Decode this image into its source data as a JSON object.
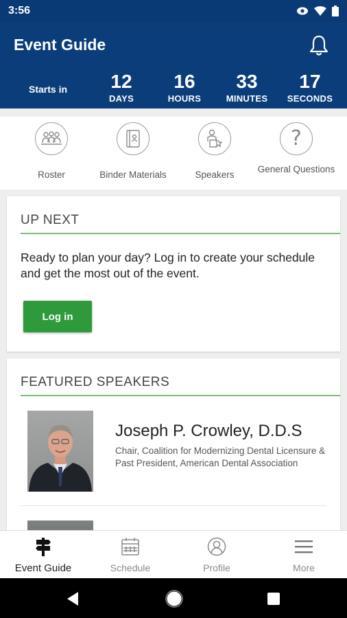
{
  "status_bar": {
    "time": "3:56",
    "icons": [
      "eye-icon",
      "wifi-icon",
      "battery-icon"
    ]
  },
  "header": {
    "title": "Event Guide",
    "icon": "bell-icon",
    "countdown": {
      "prefix": "Starts in",
      "units": [
        {
          "value": "12",
          "label": "DAYS"
        },
        {
          "value": "16",
          "label": "HOURS"
        },
        {
          "value": "33",
          "label": "MINUTES"
        },
        {
          "value": "17",
          "label": "SECONDS"
        }
      ]
    }
  },
  "quick_links": [
    {
      "label": "Roster",
      "icon": "roster-icon"
    },
    {
      "label": "Binder Materials",
      "icon": "binder-icon"
    },
    {
      "label": "Speakers",
      "icon": "speakers-icon"
    },
    {
      "label": "General Questions",
      "icon": "question-icon"
    }
  ],
  "up_next": {
    "title": "UP NEXT",
    "message": "Ready to plan your day? Log in to create your schedule and get the most out of the event.",
    "button": "Log in"
  },
  "featured_speakers": {
    "title": "FEATURED SPEAKERS",
    "speakers": [
      {
        "name": "Joseph P. Crowley, D.D.S",
        "role": "Chair, Coalition for Modernizing Dental Licensure & Past President, American Dental Association"
      }
    ]
  },
  "bottom_nav": [
    {
      "label": "Event Guide",
      "icon": "signpost-icon",
      "active": true
    },
    {
      "label": "Schedule",
      "icon": "calendar-icon",
      "active": false
    },
    {
      "label": "Profile",
      "icon": "profile-icon",
      "active": false
    },
    {
      "label": "More",
      "icon": "menu-icon",
      "active": false
    }
  ],
  "colors": {
    "header": "#0b3d7a",
    "accent_green": "#2e9a3c",
    "rule_green": "#52a84a"
  }
}
